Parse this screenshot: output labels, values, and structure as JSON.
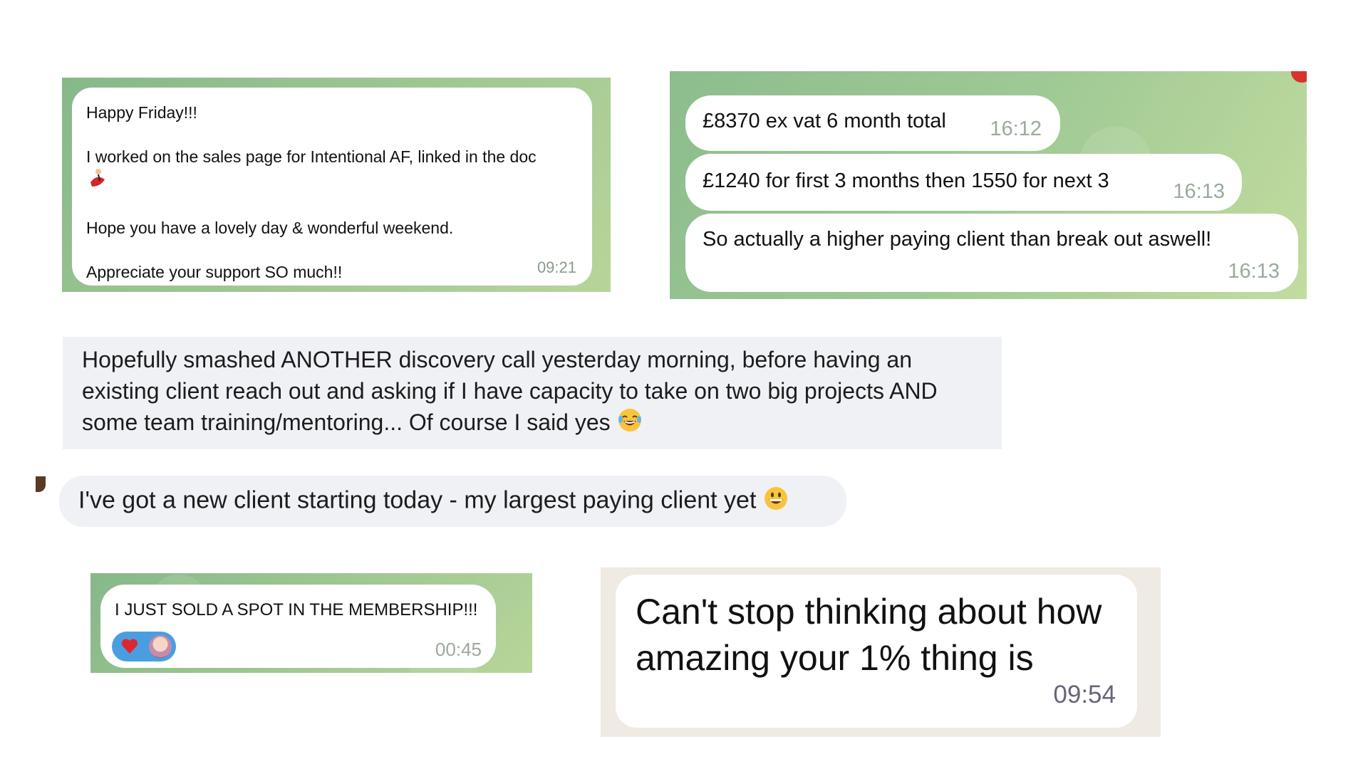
{
  "cards": {
    "card1": {
      "lines": [
        "Happy Friday!!!",
        "I worked on the sales page for Intentional AF, linked in the doc",
        "Hope you have a lovely day & wonderful weekend.",
        "Appreciate your support SO much!!"
      ],
      "time": "09:21",
      "emoji": "dancer-emoji"
    },
    "card2": {
      "messages": [
        {
          "text": "£8370 ex vat 6 month total",
          "time": "16:12"
        },
        {
          "text": "£1240 for first 3 months then 1550 for next 3",
          "time": "16:13"
        },
        {
          "text": "So actually a higher paying client than break out aswell!",
          "time": "16:13"
        }
      ]
    },
    "card3": {
      "text": "Hopefully smashed ANOTHER discovery call yesterday morning, before having an existing client reach out and asking if I have capacity to take on two big projects AND some team training/mentoring... Of course I said yes",
      "emoji": "laughing-tears-emoji"
    },
    "card4": {
      "text": "I've got a new client starting today - my largest paying client yet",
      "emoji": "grinning-face-emoji"
    },
    "card5": {
      "text": "I JUST SOLD A SPOT IN THE MEMBERSHIP!!!",
      "time": "00:45",
      "reactions": [
        "heart-icon",
        "reactor-avatar"
      ]
    },
    "card6": {
      "text": "Can't stop thinking about how amazing your 1% thing is",
      "time": "09:54"
    }
  },
  "colors": {
    "telegram_bg": "#9cc690",
    "whatsapp_bg": "#efeae2",
    "imessage_bubble": "#f0f1f5",
    "reaction_bg": "#4a9ee0"
  }
}
